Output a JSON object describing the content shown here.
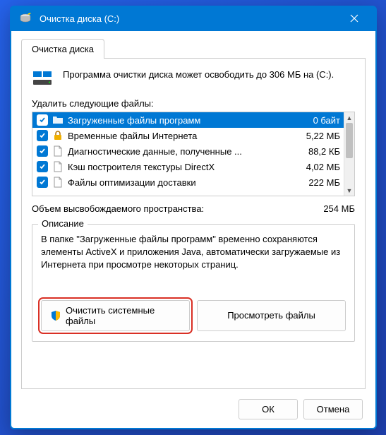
{
  "window": {
    "title": "Очистка диска  (C:)"
  },
  "tab": {
    "label": "Очистка диска"
  },
  "info": {
    "text": "Программа очистки диска может освободить до 306 МБ на (C:)."
  },
  "list": {
    "label": "Удалить следующие файлы:",
    "items": [
      {
        "name": "Загруженные файлы программ",
        "size": "0 байт",
        "checked": true,
        "selected": true,
        "icon": "folder"
      },
      {
        "name": "Временные файлы Интернета",
        "size": "5,22 МБ",
        "checked": true,
        "selected": false,
        "icon": "lock"
      },
      {
        "name": "Диагностические данные, полученные ...",
        "size": "88,2 КБ",
        "checked": true,
        "selected": false,
        "icon": "file"
      },
      {
        "name": "Кэш построителя текстуры DirectX",
        "size": "4,02 МБ",
        "checked": true,
        "selected": false,
        "icon": "file"
      },
      {
        "name": "Файлы оптимизации доставки",
        "size": "222 МБ",
        "checked": true,
        "selected": false,
        "icon": "file"
      }
    ]
  },
  "total": {
    "label": "Объем высвобождаемого пространства:",
    "value": "254 МБ"
  },
  "description": {
    "title": "Описание",
    "text": "В папке \"Загруженные файлы программ\" временно сохраняются элементы ActiveX и приложения Java, автоматически загружаемые из Интернета при просмотре некоторых страниц."
  },
  "buttons": {
    "clean_system": "Очистить системные файлы",
    "view_files": "Просмотреть файлы",
    "ok": "ОК",
    "cancel": "Отмена"
  }
}
